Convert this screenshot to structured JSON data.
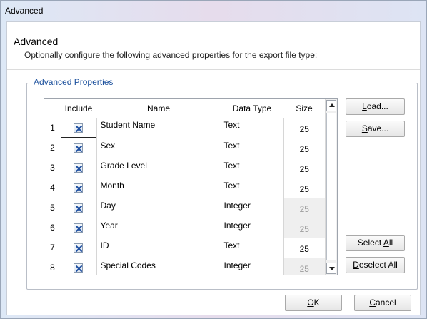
{
  "window": {
    "title": "Advanced"
  },
  "header": {
    "title": "Advanced",
    "subtitle": "Optionally configure the following advanced properties for the export file type:"
  },
  "group": {
    "label_accel": "A",
    "label_rest": "dvanced Properties"
  },
  "grid": {
    "columns": {
      "include": "Include",
      "name": "Name",
      "data_type": "Data Type",
      "size": "Size"
    },
    "rows": [
      {
        "num": "1",
        "name": "Student Name",
        "type": "Text",
        "size": "25",
        "included": true,
        "size_enabled": true
      },
      {
        "num": "2",
        "name": "Sex",
        "type": "Text",
        "size": "25",
        "included": true,
        "size_enabled": true
      },
      {
        "num": "3",
        "name": "Grade Level",
        "type": "Text",
        "size": "25",
        "included": true,
        "size_enabled": true
      },
      {
        "num": "4",
        "name": "Month",
        "type": "Text",
        "size": "25",
        "included": true,
        "size_enabled": true
      },
      {
        "num": "5",
        "name": "Day",
        "type": "Integer",
        "size": "25",
        "included": true,
        "size_enabled": false
      },
      {
        "num": "6",
        "name": "Year",
        "type": "Integer",
        "size": "25",
        "included": true,
        "size_enabled": false
      },
      {
        "num": "7",
        "name": "ID",
        "type": "Text",
        "size": "25",
        "included": true,
        "size_enabled": true
      },
      {
        "num": "8",
        "name": "Special Codes",
        "type": "Integer",
        "size": "25",
        "included": true,
        "size_enabled": false
      }
    ]
  },
  "buttons": {
    "load": {
      "accel": "L",
      "rest": "oad..."
    },
    "save": {
      "accel": "S",
      "rest": "ave..."
    },
    "select_all": {
      "before": "Select ",
      "accel": "A",
      "rest": "ll"
    },
    "deselect_all": {
      "accel": "D",
      "rest": "eselect All"
    },
    "ok": {
      "accel": "O",
      "rest": "K"
    },
    "cancel": {
      "accel": "C",
      "rest": "ancel"
    }
  },
  "colors": {
    "accent_label": "#1a4f9c",
    "check_mark": "#1f4fa0"
  },
  "icons": {
    "checkbox": "checkbox-checked-icon",
    "scroll_up": "scroll-up-arrow-icon",
    "scroll_down": "scroll-down-arrow-icon"
  }
}
